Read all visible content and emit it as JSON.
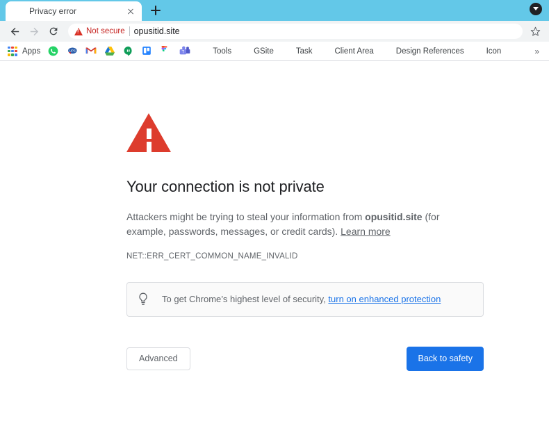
{
  "browser": {
    "tab": {
      "title": "Privacy error",
      "favicon": "globe-icon",
      "close_label": "×"
    },
    "new_tab_label": "+",
    "profile_icon": "profile-avatar-icon",
    "nav": {
      "back": "back-arrow-icon",
      "forward": "forward-arrow-icon",
      "reload": "reload-icon"
    },
    "omnibox": {
      "security_icon": "warning-triangle-icon",
      "security_label": "Not secure",
      "url": "opusitid.site",
      "bookmark_icon": "star-icon"
    },
    "bookmarks": {
      "apps_label": "Apps",
      "overflow_label": "»",
      "items": [
        {
          "label": "",
          "icon": "whatsapp-icon",
          "color": "#25D366"
        },
        {
          "label": "",
          "icon": "upsd-icon",
          "color": "#2b5eab"
        },
        {
          "label": "",
          "icon": "gmail-icon",
          "color": "#EA4335"
        },
        {
          "label": "",
          "icon": "google-drive-icon",
          "color": "#0F9D58"
        },
        {
          "label": "",
          "icon": "hangouts-icon",
          "color": "#0F9D58"
        },
        {
          "label": "",
          "icon": "trello-icon",
          "color": "#2684FF"
        },
        {
          "label": "",
          "icon": "figma-icon",
          "color": "#F24E1E"
        },
        {
          "label": "",
          "icon": "microsoft-teams-icon",
          "color": "#6264A7"
        },
        {
          "label": "Tools",
          "icon": "folder-icon",
          "color": "#F7CB4D"
        },
        {
          "label": "GSite",
          "icon": "folder-icon",
          "color": "#F7CB4D"
        },
        {
          "label": "Task",
          "icon": "folder-icon",
          "color": "#F7CB4D"
        },
        {
          "label": "Client Area",
          "icon": "folder-icon",
          "color": "#F7CB4D"
        },
        {
          "label": "Design References",
          "icon": "folder-icon",
          "color": "#F7CB4D"
        },
        {
          "label": "Icon",
          "icon": "folder-icon",
          "color": "#F7CB4D"
        }
      ]
    }
  },
  "interstitial": {
    "icon": "red-warning-triangle",
    "heading": "Your connection is not private",
    "paragraph_before_domain": "Attackers might be trying to steal your information from ",
    "domain": "opusitid.site",
    "paragraph_after_domain": " (for example, passwords, messages, or credit cards). ",
    "learn_more_label": "Learn more",
    "error_code": "NET::ERR_CERT_COMMON_NAME_INVALID",
    "tip": {
      "icon": "lightbulb-icon",
      "text_before_link": "To get Chrome’s highest level of security, ",
      "link_label": "turn on enhanced protection"
    },
    "advanced_button": "Advanced",
    "safety_button": "Back to safety"
  },
  "colors": {
    "titlebar": "#63c8e8",
    "danger": "#d93025",
    "triangle": "#dd3c2d",
    "accent": "#1a73e8",
    "toolbar_bg": "#f1f3f4",
    "text_primary": "#202124",
    "text_secondary": "#5f6368"
  }
}
